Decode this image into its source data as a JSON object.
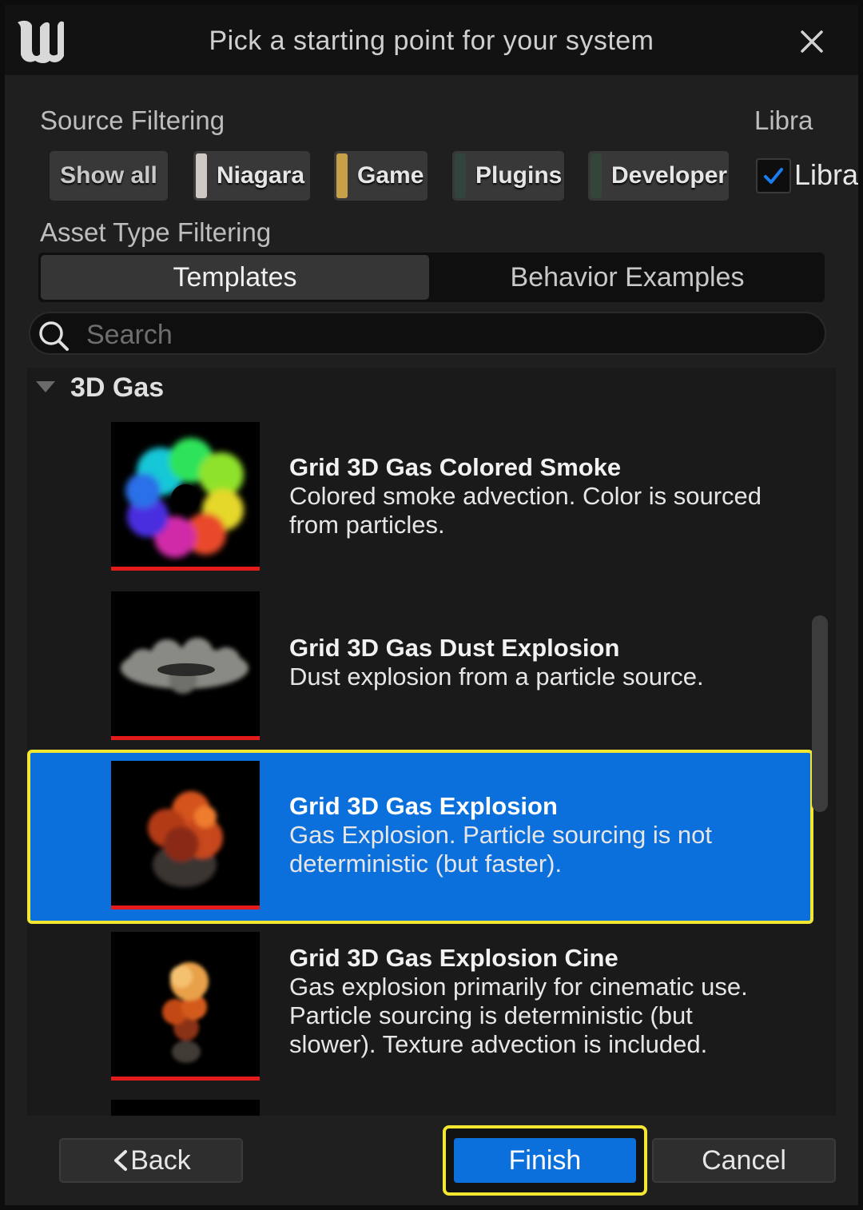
{
  "window": {
    "title": "Pick a starting point for your system"
  },
  "source_filtering": {
    "label": "Source Filtering",
    "chips": [
      {
        "label": "Show all"
      },
      {
        "label": "Niagara",
        "color": "#cfc8c4"
      },
      {
        "label": "Game",
        "color": "#c9a04a"
      },
      {
        "label": "Plugins",
        "color": "#324440"
      },
      {
        "label": "Developer",
        "color": "#34463a"
      }
    ]
  },
  "library": {
    "label": "Libra",
    "checkbox_label": "Librar",
    "checked": true
  },
  "asset_type_filtering": {
    "label": "Asset Type Filtering",
    "tabs": [
      {
        "label": "Templates",
        "active": true
      },
      {
        "label": "Behavior Examples",
        "active": false
      }
    ]
  },
  "search": {
    "placeholder": "Search",
    "value": ""
  },
  "group": {
    "label": "3D Gas",
    "items": [
      {
        "title": "Grid 3D Gas Colored Smoke",
        "desc1": "Colored smoke advection. Color is sourced",
        "desc2": "from particles.",
        "desc3": "",
        "selected": false
      },
      {
        "title": "Grid 3D Gas Dust Explosion",
        "desc1": "Dust explosion from a particle source.",
        "desc2": "",
        "desc3": "",
        "selected": false
      },
      {
        "title": "Grid 3D Gas Explosion",
        "desc1": "Gas Explosion. Particle sourcing is not",
        "desc2": "deterministic (but faster).",
        "desc3": "",
        "selected": true
      },
      {
        "title": "Grid 3D Gas Explosion Cine",
        "desc1": "Gas explosion primarily for cinematic use.",
        "desc2": "Particle sourcing is deterministic (but",
        "desc3": "slower). Texture advection is included.",
        "selected": false
      }
    ]
  },
  "buttons": {
    "back": "Back",
    "finish": "Finish",
    "cancel": "Cancel"
  },
  "colors": {
    "selection": "#0b6fdc",
    "highlight": "#f3e732",
    "thumb_bar": "#e31b1b"
  }
}
